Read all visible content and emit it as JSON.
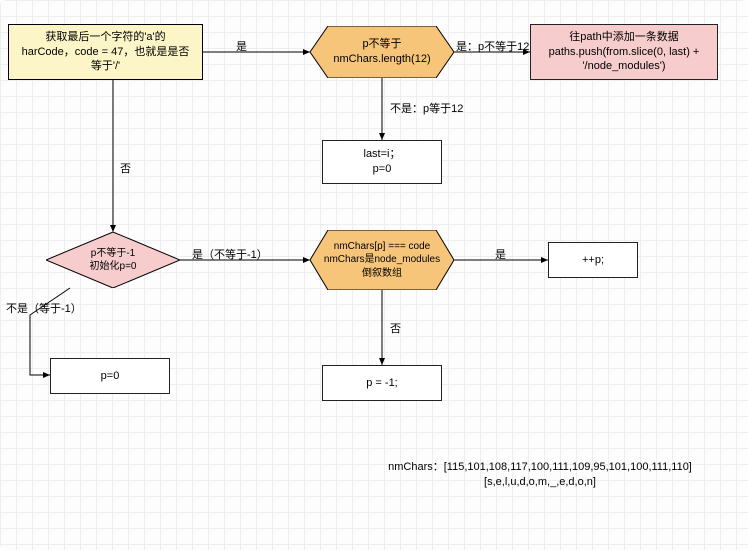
{
  "nodes": {
    "start_yellow": "获取最后一个字符的'a'的\nharCode，code = 47，也就是是否\n等于'/'",
    "hex_top": "p不等于\nnmChars.length(12)",
    "pink_push": "往path中添加一条数据\npaths.push(from.slice(0, last) +\n'/node_modules')",
    "last_i": "last=i；\np=0",
    "dia_p_neg1": "p不等于-1\n初始化p=0",
    "hex_mid": "nmChars[p] === code\nnmChars是node_modules\n倒叙数组",
    "ppp": "++p;",
    "p_zero": "p=0",
    "p_neg1": "p = -1;"
  },
  "edges": {
    "yes1": "是",
    "yes2_long": "是：p不等于12",
    "no_p12": "不是：p等于12",
    "no1": "否",
    "yes_neg1": "是（不等于-1）",
    "no_neg1": "不是（等于-1）",
    "yes3": "是",
    "no3": "否"
  },
  "footnote": "nmChars：[115,101,108,117,100,111,109,95,101,100,111,110]\n[s,e,l,u,d,o,m,_,e,d,o,n]"
}
